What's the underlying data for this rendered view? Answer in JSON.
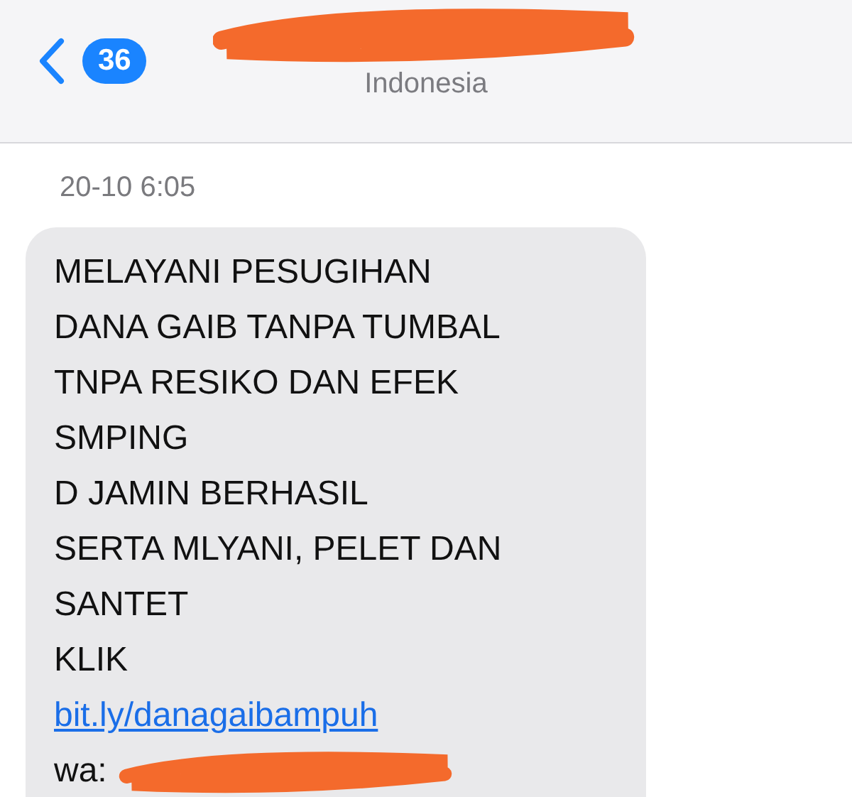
{
  "header": {
    "unread_count": "36",
    "subtitle": "Indonesia",
    "title_redacted": true
  },
  "timestamp": "20-10 6:05",
  "message": {
    "lines": [
      {
        "kind": "text",
        "text": "MELAYANI PESUGIHAN"
      },
      {
        "kind": "text",
        "text": "DANA GAIB TANPA TUMBAL"
      },
      {
        "kind": "text",
        "text": "TNPA RESIKO DAN EFEK"
      },
      {
        "kind": "text",
        "text": "SMPING"
      },
      {
        "kind": "text",
        "text": "D JAMIN BERHASIL"
      },
      {
        "kind": "text",
        "text": "SERTA MLYANI, PELET DAN"
      },
      {
        "kind": "text",
        "text": "SANTET"
      },
      {
        "kind": "text",
        "text": "KLIK"
      },
      {
        "kind": "link",
        "text": "bit.ly/danagaibampuh"
      },
      {
        "kind": "redacted",
        "text": "wa:"
      }
    ]
  }
}
